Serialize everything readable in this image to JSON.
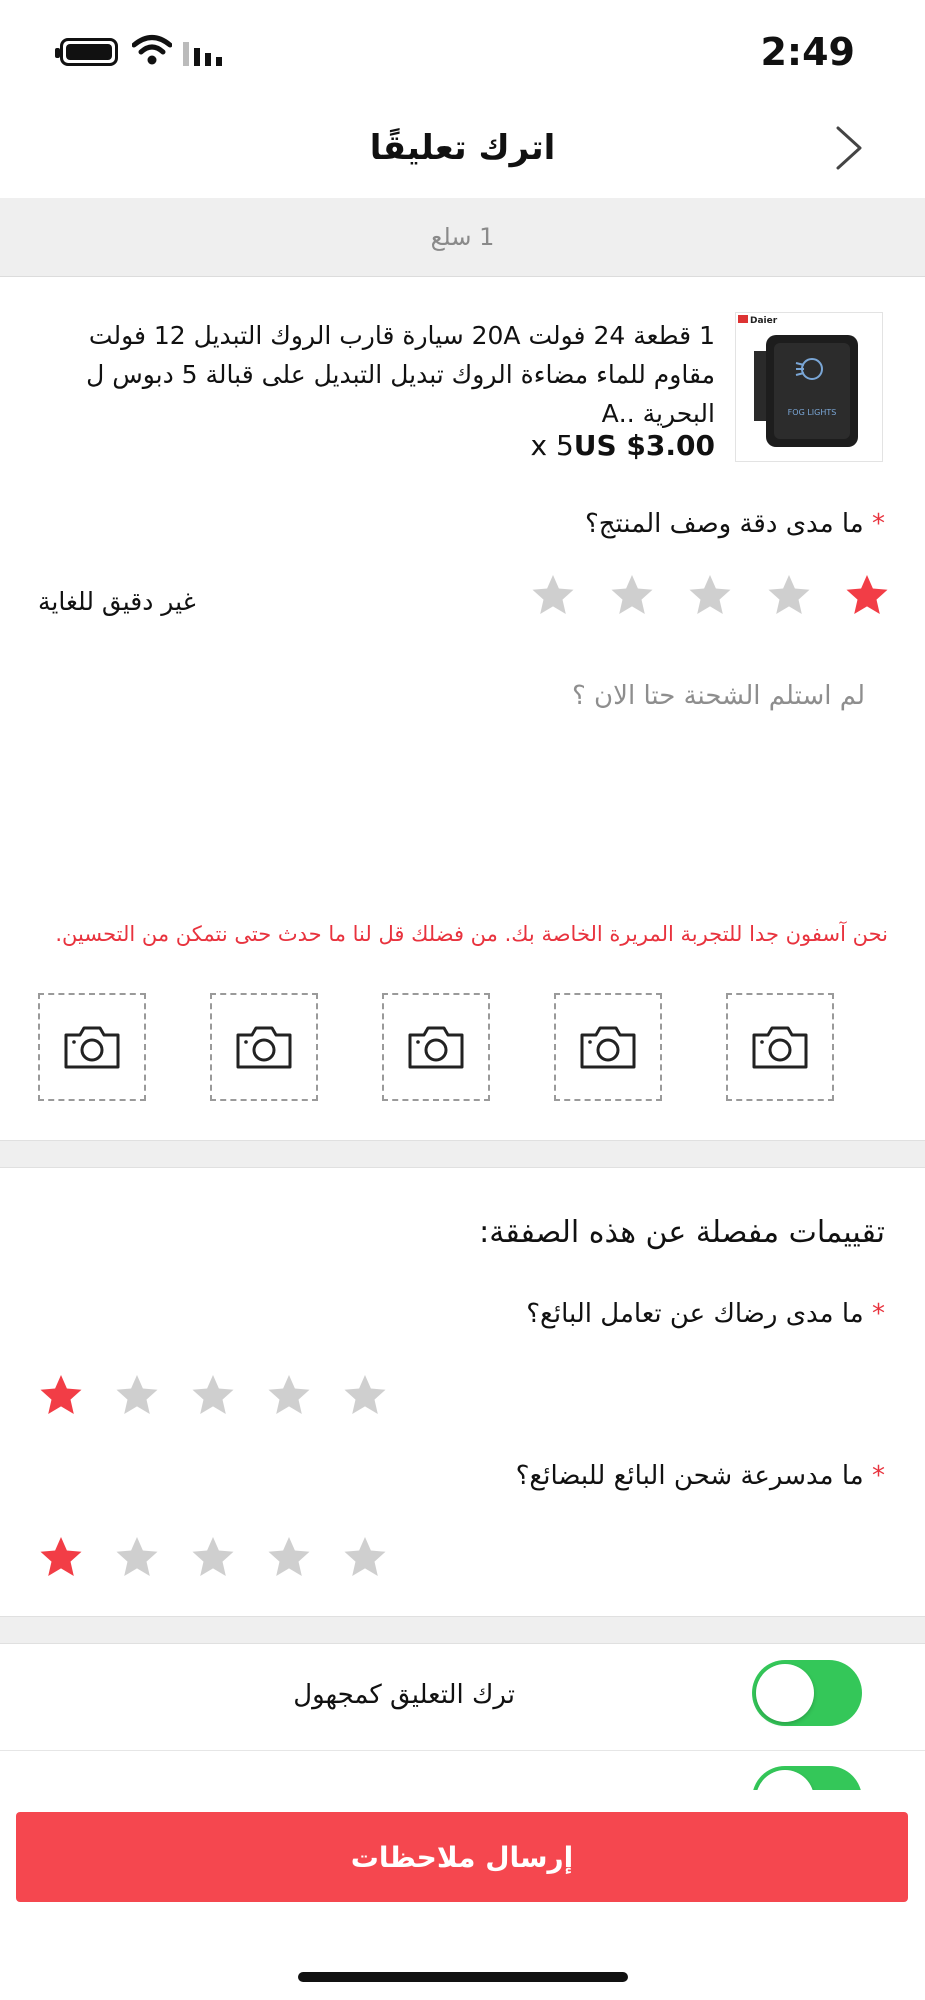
{
  "status_bar": {
    "time": "2:49"
  },
  "header": {
    "title": "اترك تعليقًا",
    "back_icon": "chevron-right-icon"
  },
  "shipment": {
    "label": "1 سلع"
  },
  "product": {
    "title": "1 قطعة 24 فولت 20A سيارة قارب الروك التبديل 12 فولت مقاوم للماء مضاءة الروك تبديل التبديل على قبالة 5 دبوس ل البحرية ..A",
    "price": "US $3.00",
    "quantity": "x 5",
    "thumb_brand": "Daier",
    "thumb_text": "FOG LIGHTS"
  },
  "description_rating": {
    "required_mark": "*",
    "question": "ما مدى دقة وصف المنتج؟",
    "rating": 1,
    "max": 5,
    "rating_text": "غير دقيق للغاية"
  },
  "comment": {
    "placeholder": "لم استلم الشحنة حتا الان ؟"
  },
  "sorry_message": "نحن آسفون جدا للتجربة المريرة الخاصة بك. من فضلك قل لنا ما حدث حتى نتمكن من التحسين.",
  "photos": {
    "count": 5,
    "icon": "camera-icon"
  },
  "detailed": {
    "title": "تقييمات مفصلة عن هذه الصفقة:",
    "seller_communication": {
      "required_mark": "*",
      "question": "ما مدى رضاك عن تعامل البائع؟",
      "rating": 1,
      "max": 5
    },
    "shipping_speed": {
      "required_mark": "*",
      "question": "ما مدسرعة شحن البائع للبضائع؟",
      "rating": 1,
      "max": 5
    }
  },
  "anonymous": {
    "label": "ترك التعليق كمجهول",
    "enabled": true
  },
  "submit": {
    "label": "إرسال ملاحظات"
  },
  "colors": {
    "accent": "#f5474f",
    "star_active": "#f23d46",
    "star_inactive": "#cfcfcf",
    "toggle_on": "#34c759"
  }
}
